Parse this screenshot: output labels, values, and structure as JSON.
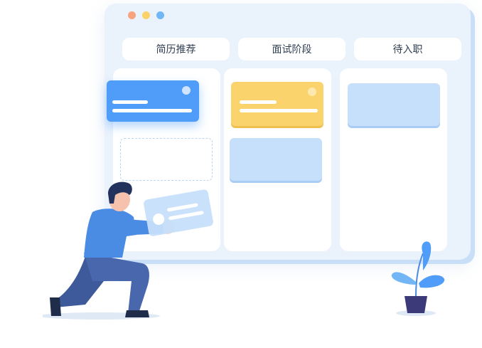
{
  "columns": [
    {
      "label": "简历推荐"
    },
    {
      "label": "面试阶段"
    },
    {
      "label": "待入职"
    }
  ],
  "window_dots": [
    "#f8a37d",
    "#fbd267",
    "#73b6f5"
  ],
  "colors": {
    "accent_blue": "#4f9df9",
    "accent_yellow": "#fbd36c",
    "light_blue_card": "#c6dffb",
    "person_shirt": "#4a8be3",
    "person_pants": "#3e5a9b",
    "plant_pot": "#3d3a7a"
  }
}
